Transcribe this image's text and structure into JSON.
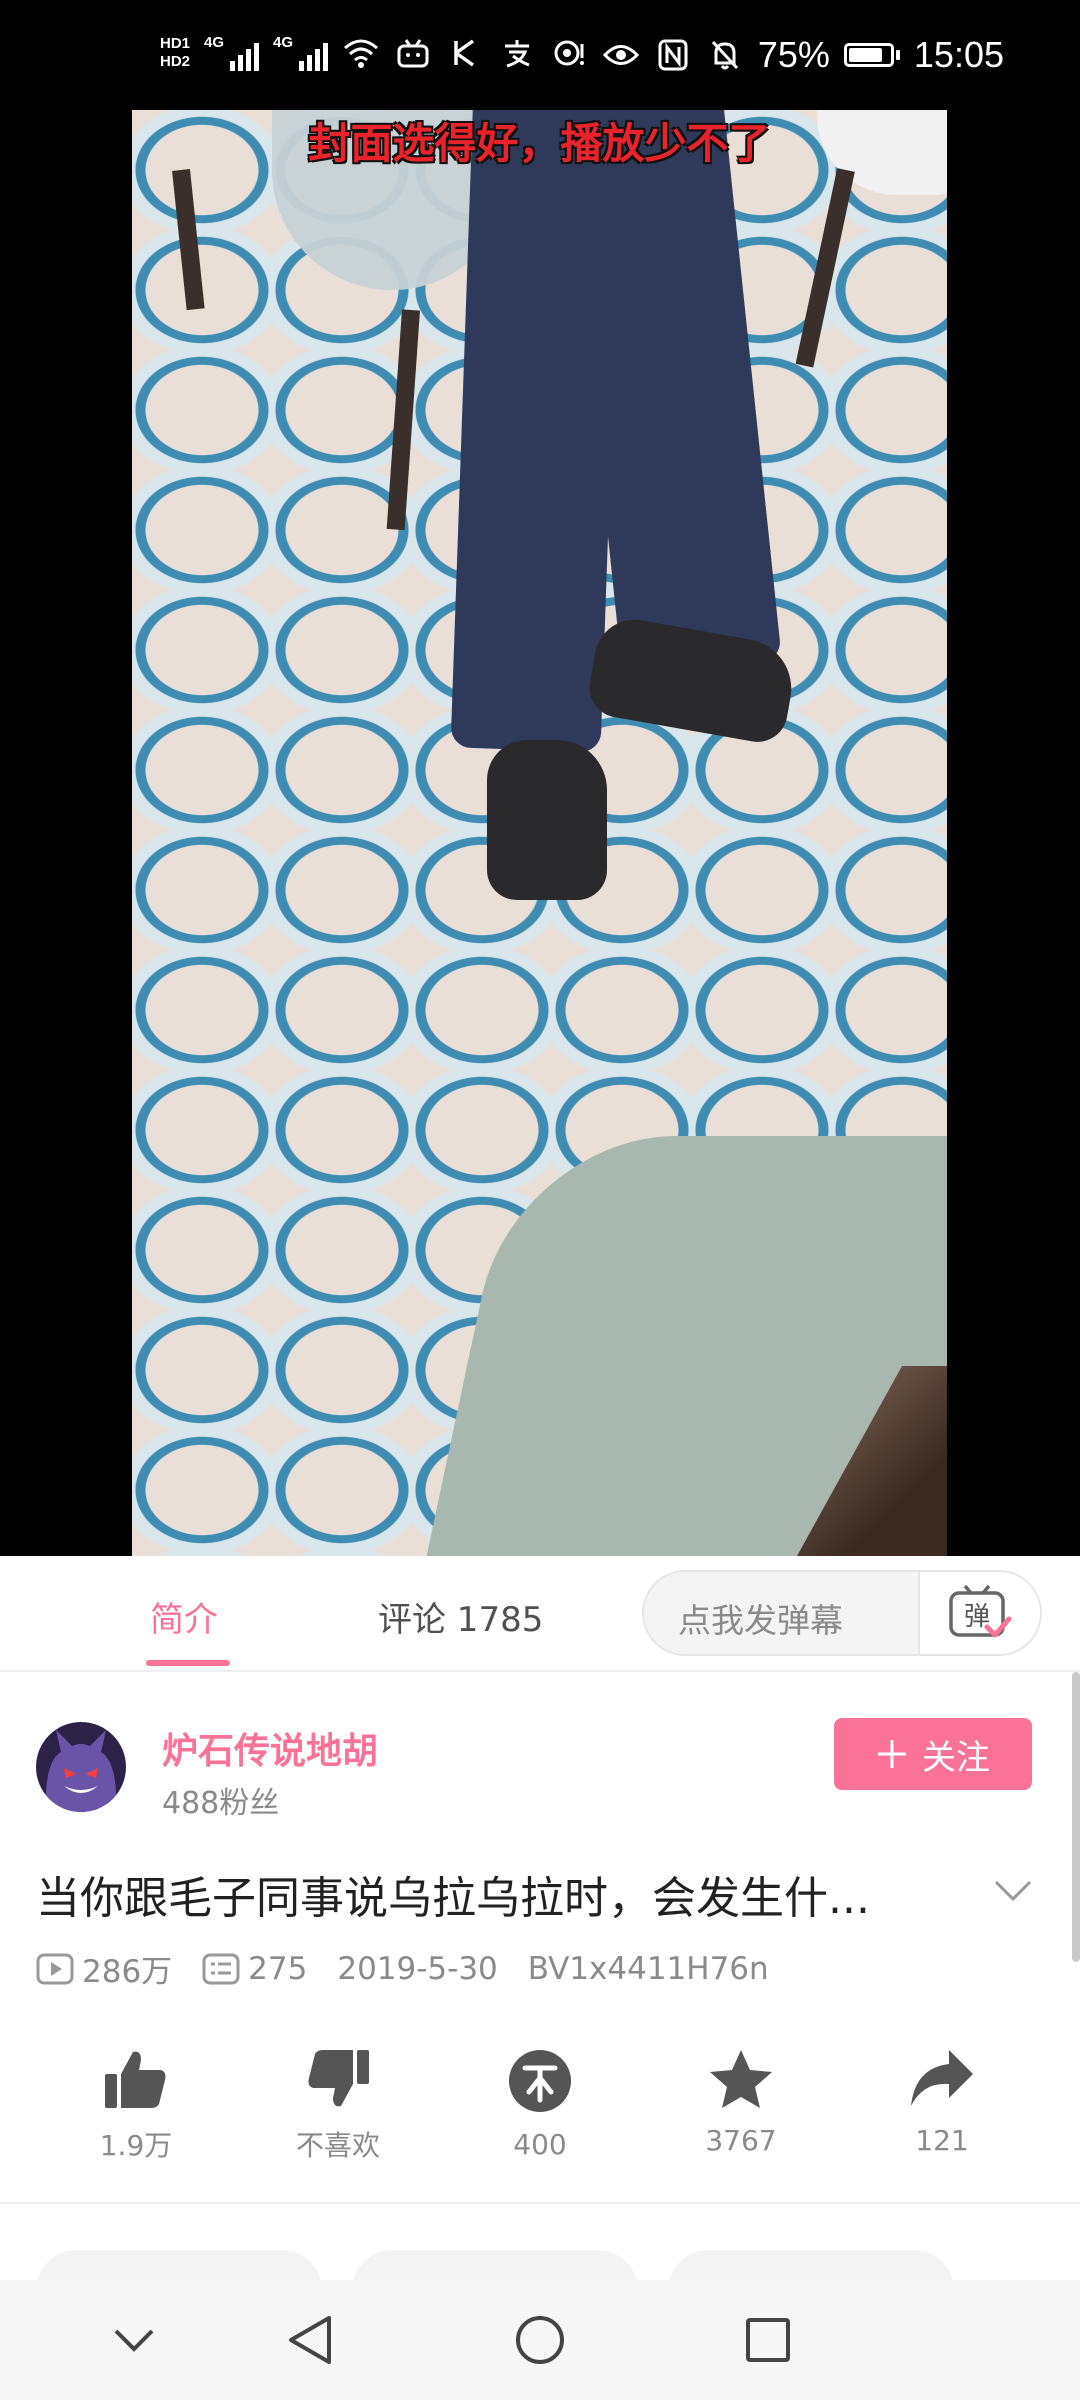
{
  "status_bar": {
    "hd1": "HD1",
    "hd2": "HD2",
    "net1": "4G",
    "net2": "4G",
    "battery": "75%",
    "time": "15:05"
  },
  "video": {
    "subtitle": "封面选得好，播放少不了"
  },
  "tabs": {
    "intro": "简介",
    "comments": "评论 1785"
  },
  "danmaku": {
    "placeholder": "点我发弹幕",
    "button_glyph": "弹"
  },
  "uploader": {
    "name": "炉石传说地胡",
    "fans": "488粉丝",
    "follow_label": "关注"
  },
  "video_info": {
    "title": "当你跟毛子同事说乌拉乌拉时，会发生什...",
    "plays": "286万",
    "danmaku_count": "275",
    "date": "2019-5-30",
    "bvid": "BV1x4411H76n"
  },
  "actions": {
    "like": "1.9万",
    "dislike": "不喜欢",
    "coin": "400",
    "favorite": "3767",
    "share": "121"
  },
  "colors": {
    "accent": "#fb7299",
    "icon_gray": "#555555",
    "text_gray": "#8a8a8a"
  }
}
